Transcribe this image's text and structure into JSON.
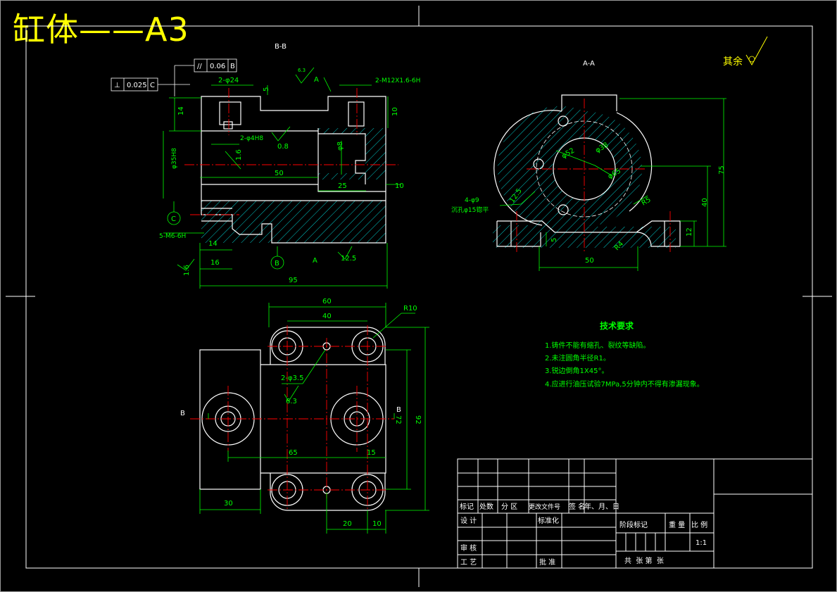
{
  "sheet_title": "缸体——A3",
  "colors": {
    "outline": "#ffffff",
    "dimension": "#00ff00",
    "hatch": "#00ffff",
    "centerline": "#ff0000",
    "title": "#ffff00",
    "background": "#000000"
  },
  "views": {
    "section_bb": "B-B",
    "section_aa": "A-A"
  },
  "roughness_note": "其余",
  "front_view": {
    "dims": {
      "d95": "95",
      "d50": "50",
      "d25": "25",
      "d10": "10",
      "d10b": "10",
      "d14": "14",
      "d14b": "14",
      "d16": "16",
      "d5": "5",
      "d8": "φ8",
      "d12_5": "12.5",
      "d1_6": "1.6",
      "d1_6b": "1.6",
      "d0_8": "0.8",
      "d6_3": "6.3"
    },
    "labels": {
      "holes_24": "2-φ24",
      "thread_m12": "2-M12X1.6-6H",
      "holes_4": "2-φ4H8",
      "thread_m6": "5-M6-6H",
      "bore": "φ35H8",
      "sec_a": "A",
      "sec_a2": "A"
    },
    "datums": {
      "datum_c": "C",
      "datum_b": "B"
    },
    "tolerances": {
      "parallel_sym": "//",
      "parallel_val": "0.06",
      "parallel_ref": "B",
      "perp_sym": "⊥",
      "perp_val": "0.025",
      "perp_ref": "C"
    }
  },
  "side_view": {
    "dims": {
      "d75": "75",
      "d40": "40",
      "d50": "50",
      "d12": "12",
      "d5": "5",
      "d12_5": "12.5"
    },
    "labels": {
      "dia_52": "φ52",
      "dia_38": "φ38",
      "dia_65": "φ65",
      "r5": "R5",
      "r4": "R4",
      "holes": "4-φ9",
      "counterbore": "沉孔φ15锪平"
    }
  },
  "top_view": {
    "dims": {
      "d60": "60",
      "d40": "40",
      "d65": "65",
      "d15": "15",
      "d30": "30",
      "d20": "20",
      "d10": "10",
      "d72": "72",
      "d92": "92",
      "r10": "R10",
      "d6_3": "6.3"
    },
    "labels": {
      "holes": "2-φ3.5",
      "sec_b": "B",
      "sec_b2": "B"
    }
  },
  "tech_req": {
    "heading": "技术要求",
    "items": [
      "1.铸件不能有缩孔、裂纹等缺陷。",
      "2.未注圆角半径R1。",
      "3.锐边倒角1X45°。",
      "4.应进行油压试验7MPa,5分钟内不得有渗漏现象。"
    ]
  },
  "title_block": {
    "mark": "标记",
    "count": "处数",
    "zone": "分 区",
    "change_doc": "更改文件号",
    "signature": "签 名",
    "date": "年、月、日",
    "design": "设 计",
    "standardize": "标准化",
    "stage_mark": "阶段标记",
    "weight": "重 量",
    "scale": "比 例",
    "scale_val": "1:1",
    "review": "审 核",
    "process": "工 艺",
    "approve": "批 准",
    "sheets": "共  张 第  张"
  }
}
